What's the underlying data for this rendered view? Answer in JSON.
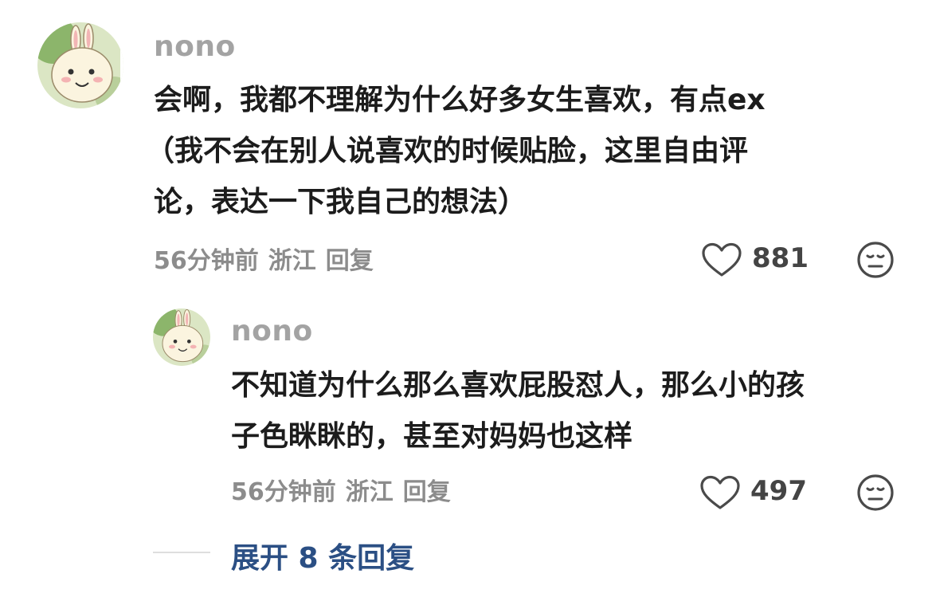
{
  "comment": {
    "username": "nono",
    "lines": [
      "会啊，我都不理解为什么好多女生喜欢，有点ex",
      "（我不会在别人说喜欢的时候贴脸，这里自由评",
      "论，表达一下我自己的想法）"
    ],
    "time": "56分钟前",
    "location": "浙江",
    "reply_label": "回复",
    "likes": "881"
  },
  "reply": {
    "username": "nono",
    "lines": [
      "不知道为什么那么喜欢屁股怼人，那么小的孩",
      "子色眯眯的，甚至对妈妈也这样"
    ],
    "time": "56分钟前",
    "location": "浙江",
    "reply_label": "回复",
    "likes": "497"
  },
  "expand_label": "展开 8 条回复",
  "colors": {
    "username": "#a3a3a3",
    "text": "#1c1c1c",
    "meta": "#8c8c8c",
    "link": "#2b4f84"
  },
  "icons": [
    "avatar",
    "heart-icon",
    "meh-face-icon"
  ]
}
